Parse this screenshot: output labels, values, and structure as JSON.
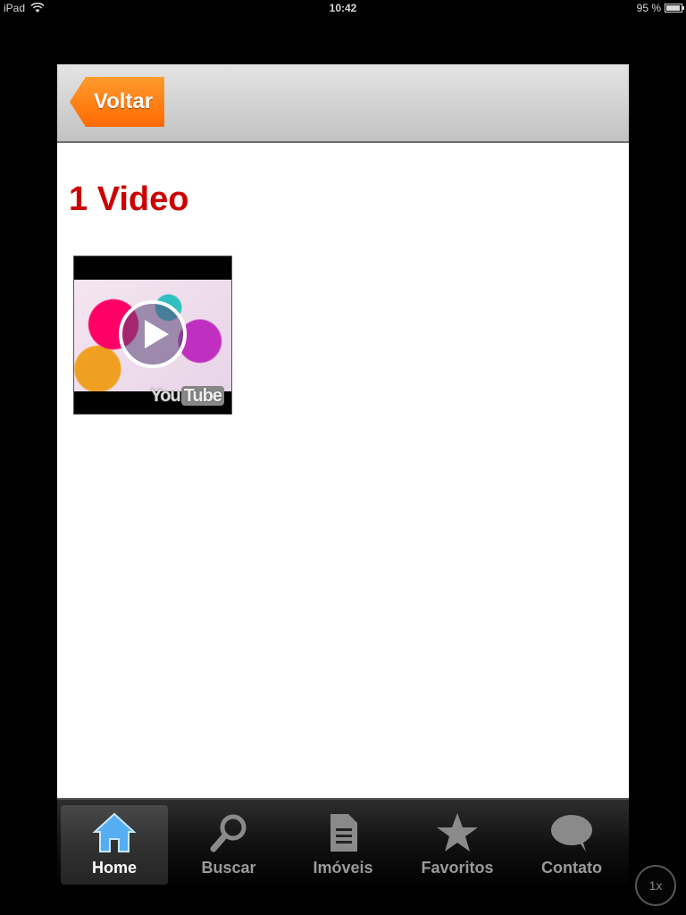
{
  "status_bar": {
    "device": "iPad",
    "time": "10:42",
    "battery": "95 %",
    "battery_level": 0.95
  },
  "nav": {
    "back_label": "Voltar"
  },
  "content": {
    "title": "1 Video",
    "video": {
      "logo_you": "You",
      "logo_tube": "Tube"
    }
  },
  "tabs": [
    {
      "label": "Home",
      "icon": "home-icon",
      "active": true
    },
    {
      "label": "Buscar",
      "icon": "search-icon",
      "active": false
    },
    {
      "label": "Imóveis",
      "icon": "document-icon",
      "active": false
    },
    {
      "label": "Favoritos",
      "icon": "star-icon",
      "active": false
    },
    {
      "label": "Contato",
      "icon": "chat-bubble-icon",
      "active": false
    }
  ],
  "zoom": "1x",
  "colors": {
    "title": "#cc0000",
    "back_button": "#ff6a00",
    "active_tab_icon": "#3aa0f0"
  }
}
